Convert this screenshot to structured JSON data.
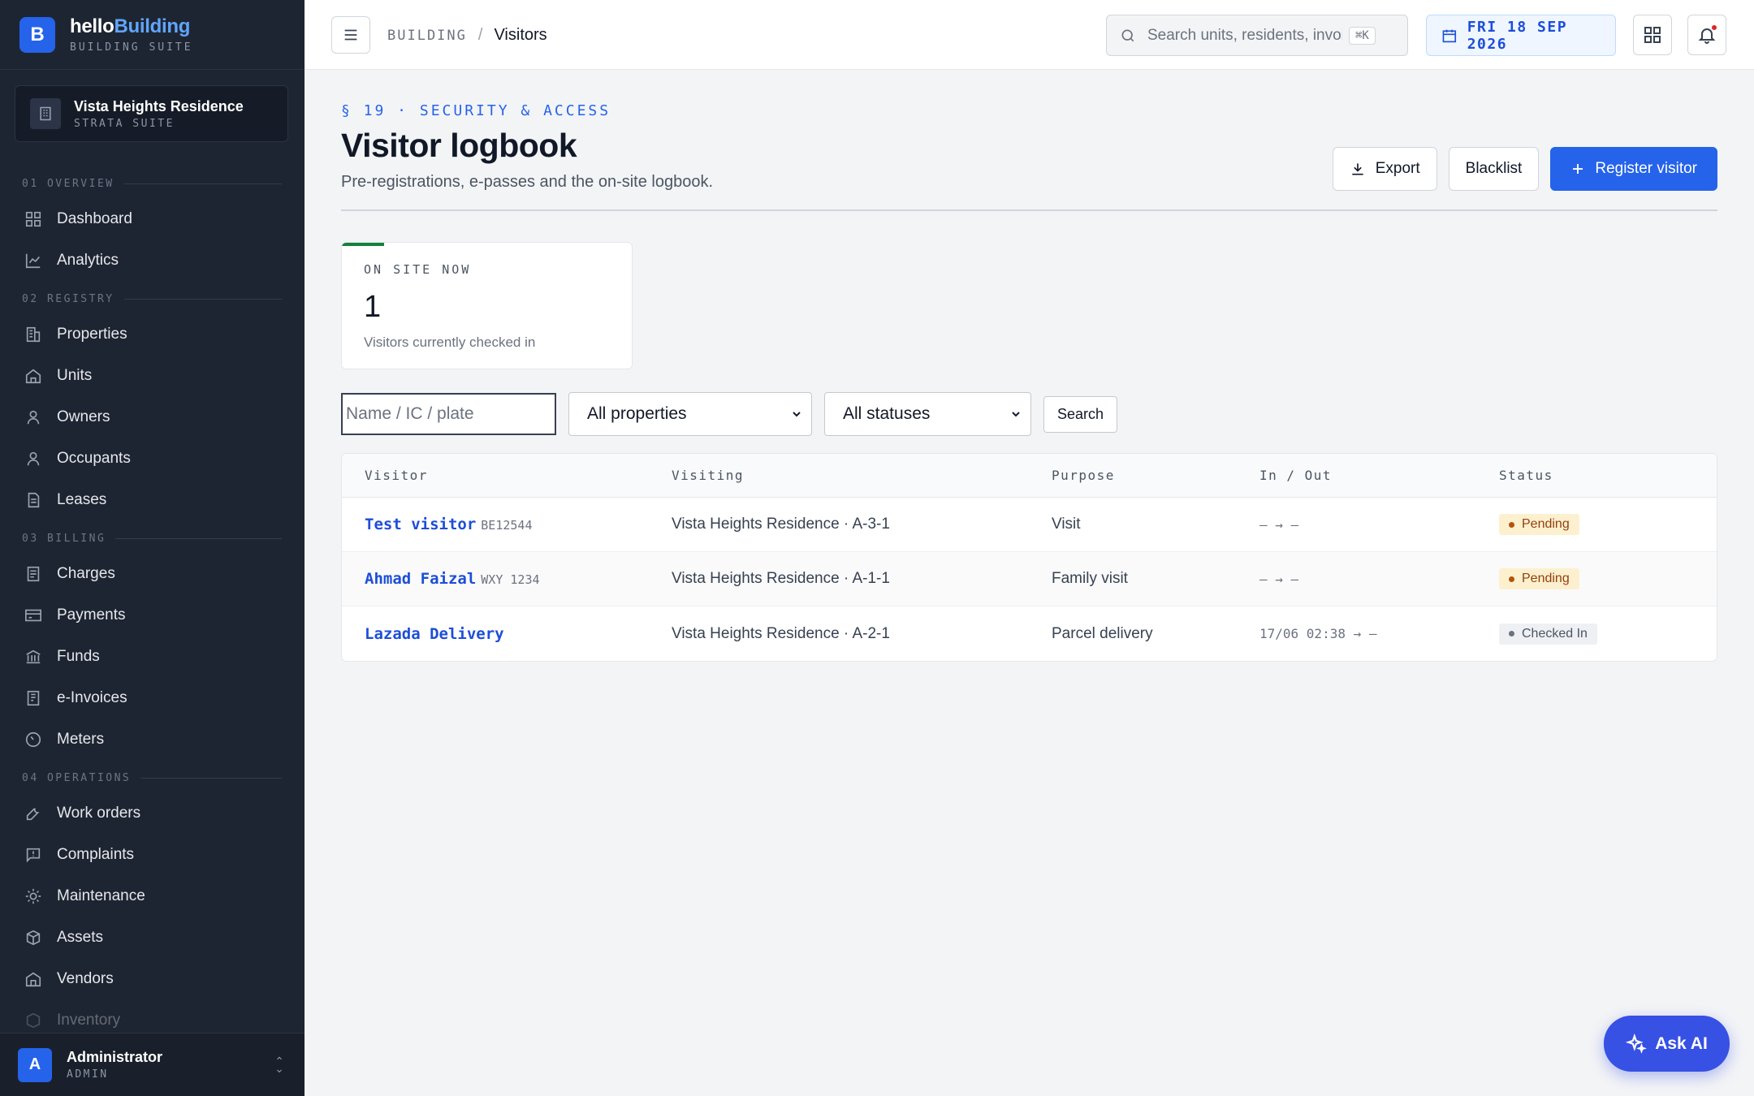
{
  "brand": {
    "name_part1": "hello",
    "name_part2": "Building",
    "subtitle": "BUILDING SUITE",
    "logo_letter": "B"
  },
  "property": {
    "name": "Vista Heights Residence",
    "subtitle": "STRATA SUITE"
  },
  "sidebar": {
    "sections": [
      {
        "label": "01 OVERVIEW",
        "items": [
          {
            "label": "Dashboard",
            "icon": "dashboard-icon"
          },
          {
            "label": "Analytics",
            "icon": "analytics-icon"
          }
        ]
      },
      {
        "label": "02 REGISTRY",
        "items": [
          {
            "label": "Properties",
            "icon": "building-icon"
          },
          {
            "label": "Units",
            "icon": "home-icon"
          },
          {
            "label": "Owners",
            "icon": "person-icon"
          },
          {
            "label": "Occupants",
            "icon": "person-icon"
          },
          {
            "label": "Leases",
            "icon": "document-icon"
          }
        ]
      },
      {
        "label": "03 BILLING",
        "items": [
          {
            "label": "Charges",
            "icon": "receipt-icon"
          },
          {
            "label": "Payments",
            "icon": "card-icon"
          },
          {
            "label": "Funds",
            "icon": "bank-icon"
          },
          {
            "label": "e-Invoices",
            "icon": "invoice-icon"
          },
          {
            "label": "Meters",
            "icon": "gauge-icon"
          }
        ]
      },
      {
        "label": "04 OPERATIONS",
        "items": [
          {
            "label": "Work orders",
            "icon": "wrench-icon"
          },
          {
            "label": "Complaints",
            "icon": "message-alert-icon"
          },
          {
            "label": "Maintenance",
            "icon": "sun-icon"
          },
          {
            "label": "Assets",
            "icon": "box-icon"
          },
          {
            "label": "Vendors",
            "icon": "store-icon"
          },
          {
            "label": "Inventory",
            "icon": "package-icon"
          }
        ]
      }
    ]
  },
  "user": {
    "initial": "A",
    "name": "Administrator",
    "role": "ADMIN"
  },
  "topbar": {
    "breadcrumb_root": "BUILDING",
    "breadcrumb_sep": "/",
    "breadcrumb_current": "Visitors",
    "search_placeholder": "Search units, residents, invoices",
    "search_shortcut": "⌘K",
    "date": "FRI 18 SEP 2026"
  },
  "page": {
    "section_tag": "§ 19 · SECURITY & ACCESS",
    "title": "Visitor logbook",
    "subtitle": "Pre-registrations, e-passes and the on-site logbook.",
    "actions": {
      "export": "Export",
      "blacklist": "Blacklist",
      "register": "Register visitor"
    }
  },
  "stat": {
    "label": "ON SITE NOW",
    "value": "1",
    "caption": "Visitors currently checked in",
    "accent_color": "#15803d"
  },
  "filters": {
    "name_placeholder": "Name / IC / plate",
    "property_selected": "All properties",
    "status_selected": "All statuses",
    "search_label": "Search"
  },
  "table": {
    "columns": [
      "Visitor",
      "Visiting",
      "Purpose",
      "In / Out",
      "Status"
    ],
    "rows": [
      {
        "visitor": "Test visitor",
        "plate": "BE12544",
        "visiting": "Vista Heights Residence · A-3-1",
        "purpose": "Visit",
        "inout": "— → —",
        "status": "Pending"
      },
      {
        "visitor": "Ahmad Faizal",
        "plate": "WXY 1234",
        "visiting": "Vista Heights Residence · A-1-1",
        "purpose": "Family visit",
        "inout": "— → —",
        "status": "Pending"
      },
      {
        "visitor": "Lazada Delivery",
        "plate": "",
        "visiting": "Vista Heights Residence · A-2-1",
        "purpose": "Parcel delivery",
        "inout": "17/06 02:38 → —",
        "status": "Checked In"
      }
    ]
  },
  "ask_ai": {
    "label": "Ask AI"
  },
  "colors": {
    "primary": "#2563eb",
    "sidebar_bg": "#1e2532",
    "pending_bg": "#fdf0cf",
    "pending_text": "#92400e"
  }
}
